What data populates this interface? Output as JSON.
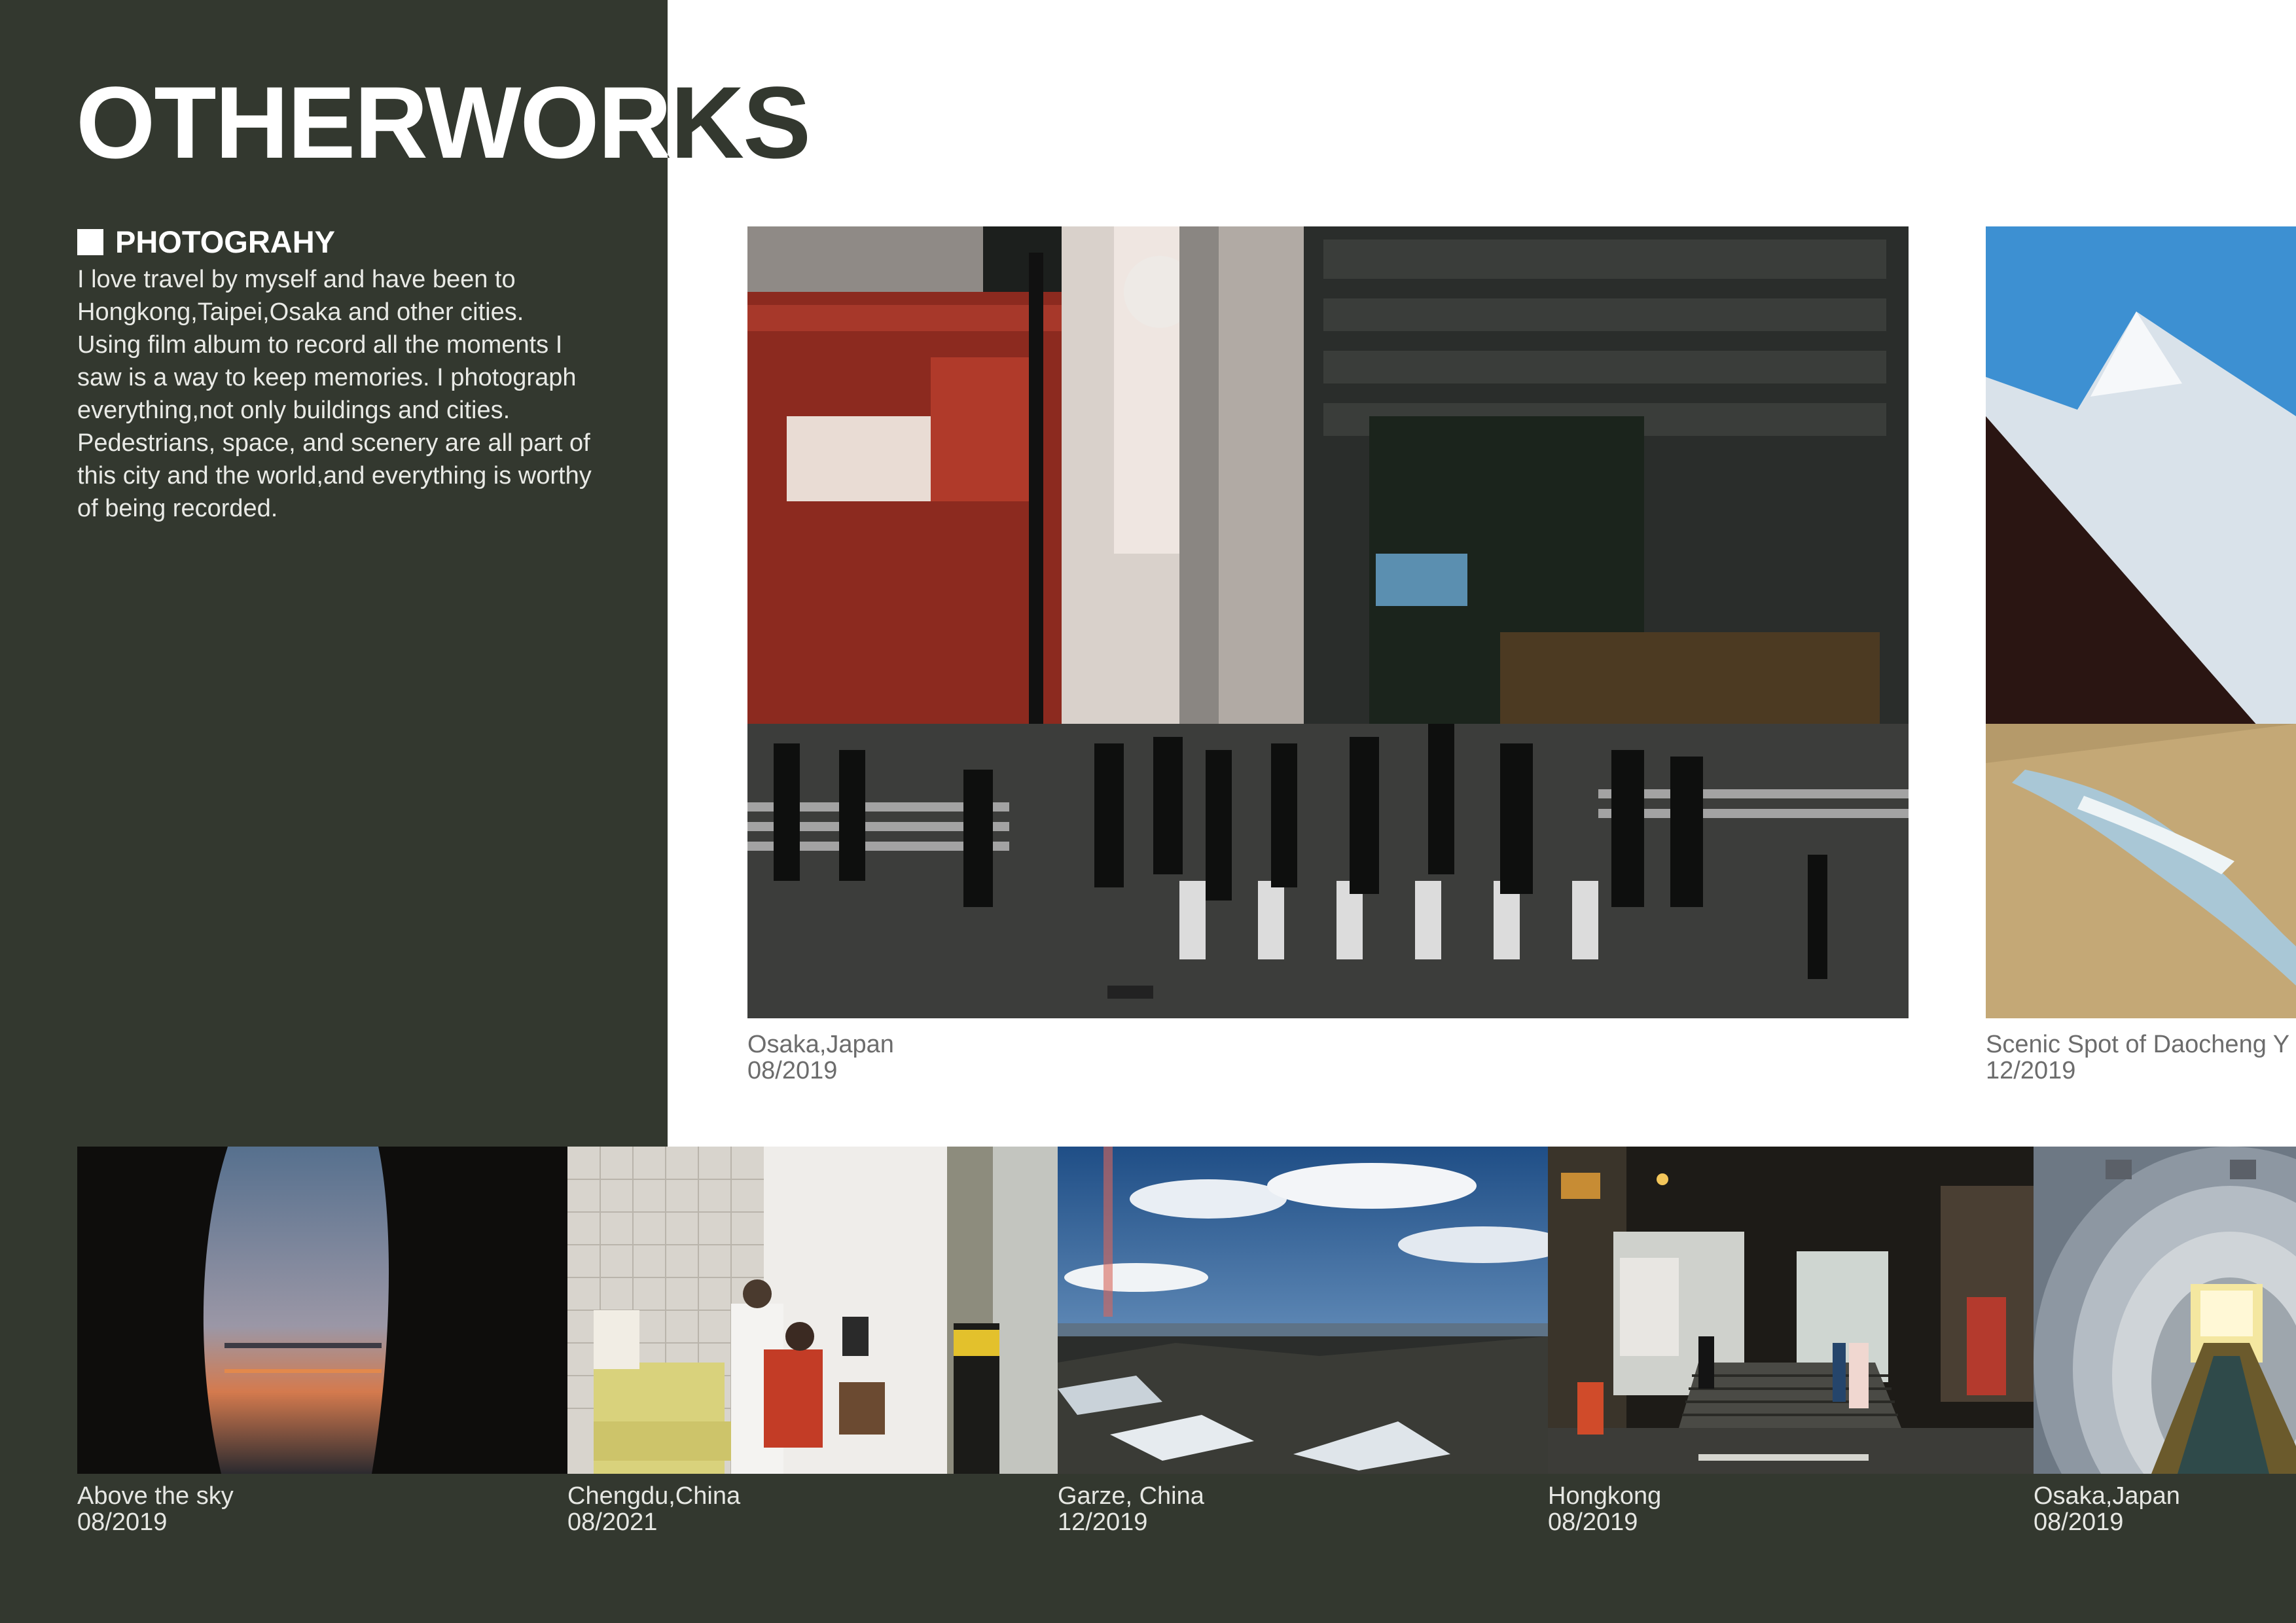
{
  "header": {
    "title": "OTHERWORKS"
  },
  "section": {
    "heading": "PHOTOGRAHY",
    "body": "I love travel by myself and have been to\nHongkong,Taipei,Osaka and other cities.\nUsing film album to record all the moments I\nsaw is a way to keep memories. I photograph\neverything,not only buildings and cities.\nPedestrians, space, and scenery are all part of\nthis city and the world,and everything is worthy\nof being recorded."
  },
  "featured": [
    {
      "place": "Osaka,Japan",
      "date": "08/2019"
    },
    {
      "place": "Scenic Spot of Daocheng Y",
      "date": "12/2019"
    }
  ],
  "gallery": [
    {
      "place": "Above the sky",
      "date": "08/2019"
    },
    {
      "place": "Chengdu,China",
      "date": "08/2021"
    },
    {
      "place": "Garze, China",
      "date": "12/2019"
    },
    {
      "place": "Hongkong",
      "date": "08/2019"
    },
    {
      "place": "Osaka,Japan",
      "date": "08/2019"
    }
  ],
  "colors": {
    "panel": "#33382f",
    "page": "#ffffff"
  }
}
